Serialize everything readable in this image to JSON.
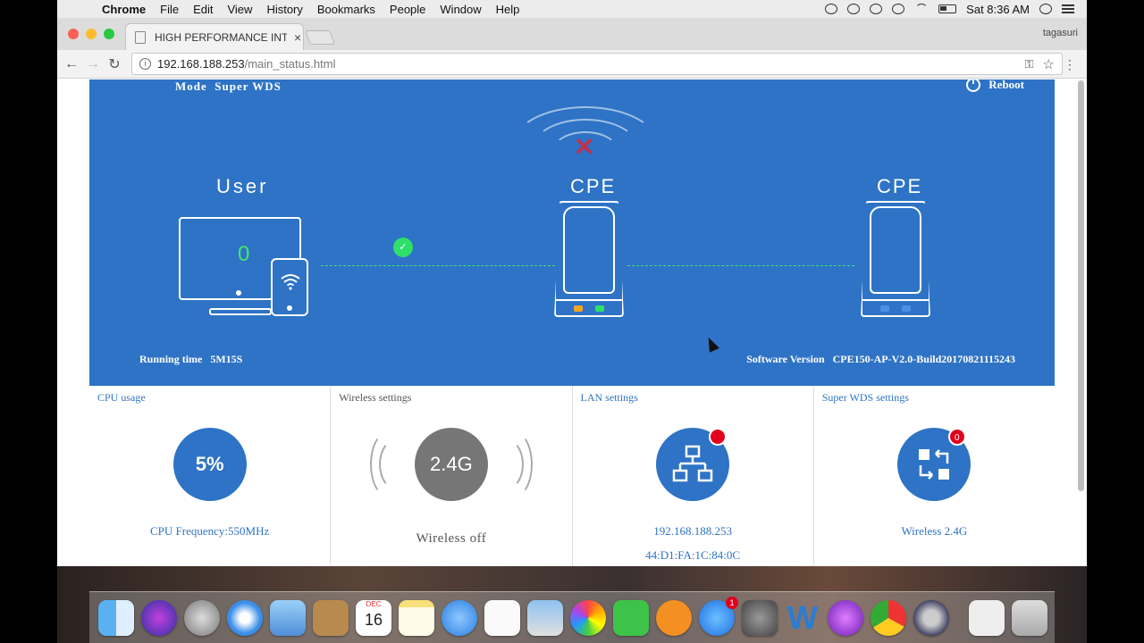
{
  "menubar": {
    "apple": "",
    "app_name": "Chrome",
    "items": [
      "File",
      "Edit",
      "View",
      "History",
      "Bookmarks",
      "People",
      "Window",
      "Help"
    ],
    "clock": "Sat 8:36 AM"
  },
  "browser": {
    "tab_title": "HIGH PERFORMANCE INTELLIG",
    "tab_close": "×",
    "profile": "tagasuri",
    "url_host": "192.168.188.253",
    "url_path": "/main_status.html",
    "back": "←",
    "forward": "→",
    "reload": "↻",
    "key_icon": "⚿",
    "star": "☆",
    "menu": "⋮"
  },
  "page": {
    "mode_label": "Mode",
    "mode_value": "Super WDS",
    "reboot_label": "Reboot",
    "user_label": "User",
    "user_count": "0",
    "cpe_left_label": "CPE",
    "cpe_right_label": "CPE",
    "running_label": "Running time",
    "running_value": "5M15S",
    "software_label": "Software Version",
    "software_value": "CPE150-AP-V2.0-Build20170821115243",
    "check_mark": "✓",
    "x_mark": "✕",
    "colors": {
      "hero_bg": "#2e73c5",
      "link_green": "#40e080",
      "led_orange": "#f5a623",
      "led_green": "#2ee06a",
      "led_blue": "#4a90e2",
      "badge_red": "#e0001b"
    }
  },
  "panels": {
    "cpu": {
      "title": "CPU usage",
      "value": "5%",
      "sub": "CPU Frequency:550MHz"
    },
    "wireless": {
      "title": "Wireless settings",
      "value": "2.4G",
      "sub": "Wireless off"
    },
    "lan": {
      "title": "LAN settings",
      "ip": "192.168.188.253",
      "mac": "44:D1:FA:1C:84:0C",
      "icon": "network-icon"
    },
    "wds": {
      "title": "Super WDS settings",
      "badge": "0",
      "sub": "Wireless 2.4G",
      "icon": "swap-icon"
    }
  },
  "dock": {
    "calendar_month": "DEC",
    "calendar_day": "16",
    "appstore_badge": "1",
    "apps": [
      "finder-icon",
      "siri-icon",
      "launchpad-icon",
      "safari-icon",
      "mail-icon",
      "contacts-icon",
      "calendar-icon",
      "notes-icon",
      "messages-icon",
      "reminders-icon",
      "preview-icon",
      "photos-icon",
      "facetime-icon",
      "ibooks-icon",
      "appstore-icon",
      "system-preferences-icon",
      "word-icon",
      "cc-icon",
      "chrome-icon",
      "quicktime-icon",
      "music-folder-icon",
      "trash-icon"
    ]
  }
}
